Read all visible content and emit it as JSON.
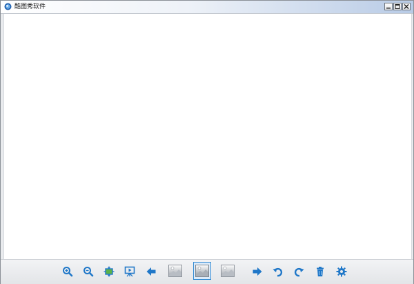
{
  "window": {
    "title": "酷图秀软件",
    "controls": {
      "minimize": "minimize-icon",
      "maximize": "maximize-icon",
      "close": "close-icon"
    }
  },
  "toolbar": {
    "buttons": [
      {
        "name": "zoom-in",
        "icon": "zoom-in-icon"
      },
      {
        "name": "zoom-out",
        "icon": "zoom-out-icon"
      },
      {
        "name": "fit-window",
        "icon": "fit-window-icon"
      },
      {
        "name": "slideshow",
        "icon": "slideshow-icon"
      },
      {
        "name": "previous",
        "icon": "arrow-left-icon"
      },
      {
        "name": "thumbnail-1",
        "icon": "image-thumbnail-icon"
      },
      {
        "name": "thumbnail-2",
        "icon": "image-thumbnail-icon",
        "selected": true
      },
      {
        "name": "thumbnail-3",
        "icon": "image-thumbnail-icon"
      },
      {
        "name": "next",
        "icon": "arrow-right-icon"
      },
      {
        "name": "rotate-left",
        "icon": "rotate-left-icon"
      },
      {
        "name": "rotate-right",
        "icon": "rotate-right-icon"
      },
      {
        "name": "delete",
        "icon": "trash-icon"
      },
      {
        "name": "settings",
        "icon": "gear-icon"
      }
    ]
  },
  "colors": {
    "accent": "#1f77c8",
    "titlebar_end": "#b8cbe6",
    "canvas": "#ffffff"
  }
}
